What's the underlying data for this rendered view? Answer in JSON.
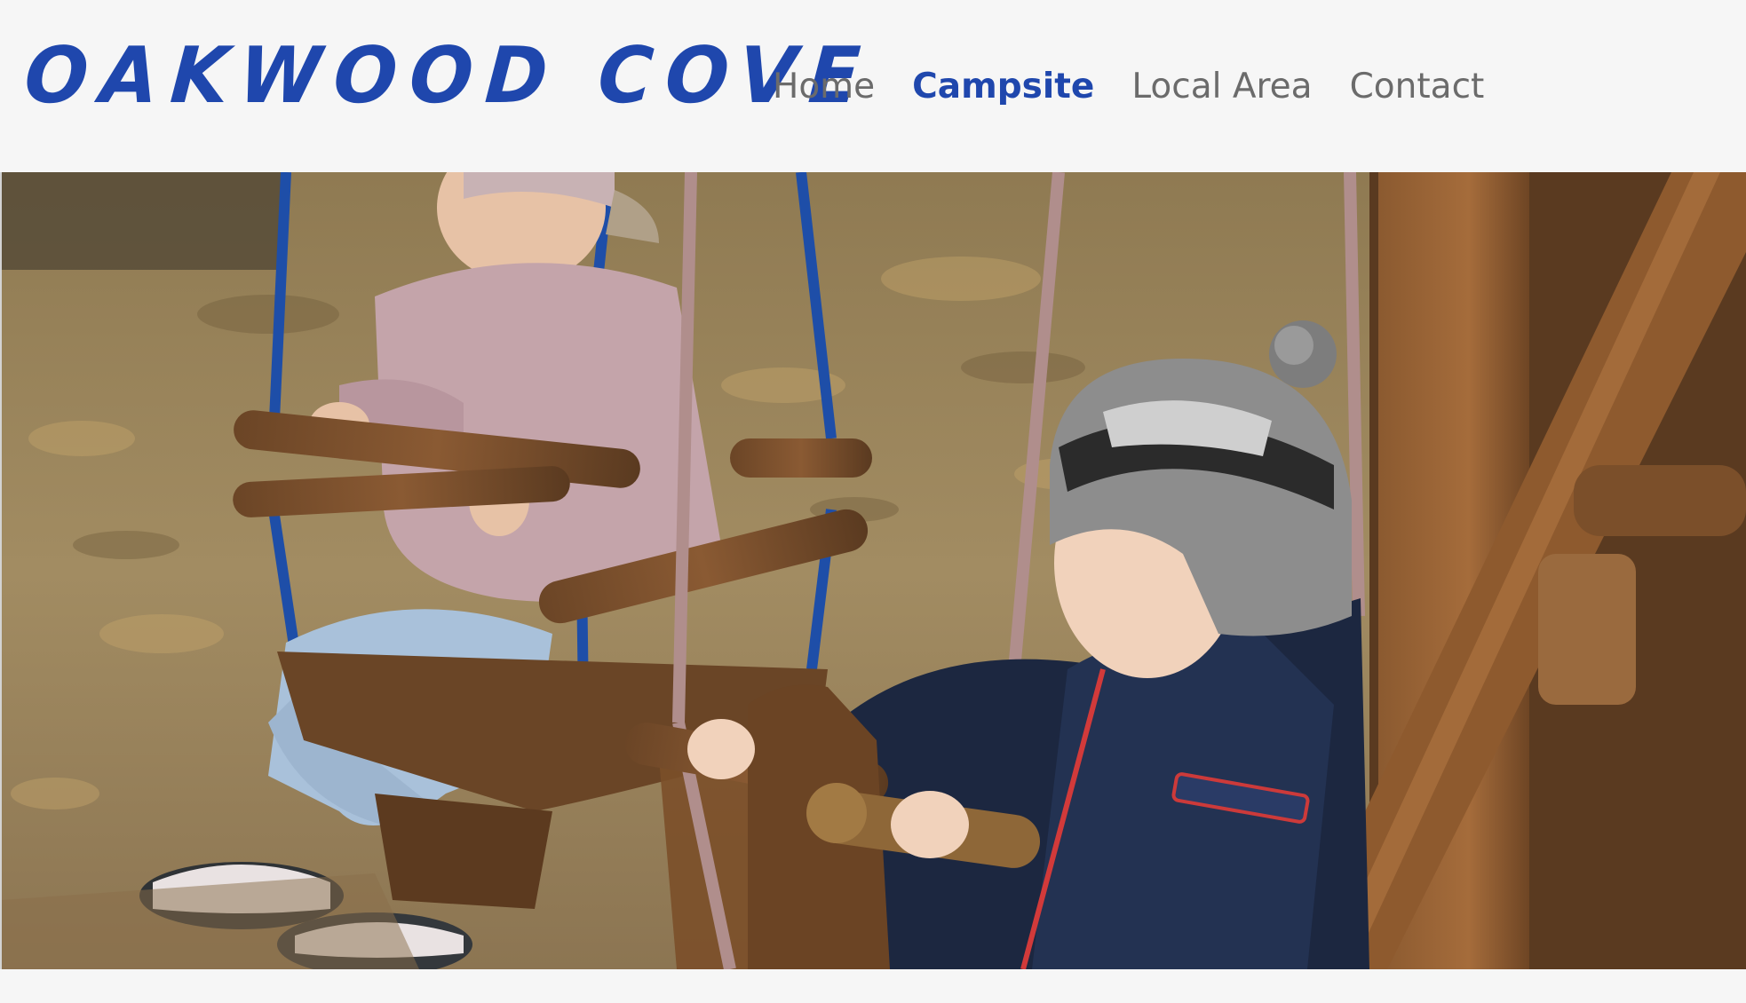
{
  "site": {
    "logo_text": "OAKWOOD COVE"
  },
  "nav": {
    "items": [
      {
        "label": "Home",
        "active": false
      },
      {
        "label": "Campsite",
        "active": true
      },
      {
        "label": "Local Area",
        "active": false
      },
      {
        "label": "Contact",
        "active": false
      }
    ]
  },
  "colors": {
    "brand": "#1f47ad",
    "nav": "#6b6b6b",
    "background": "#f6f6f6"
  },
  "hero": {
    "subject": "two-children-on-playground-swings-photo"
  }
}
